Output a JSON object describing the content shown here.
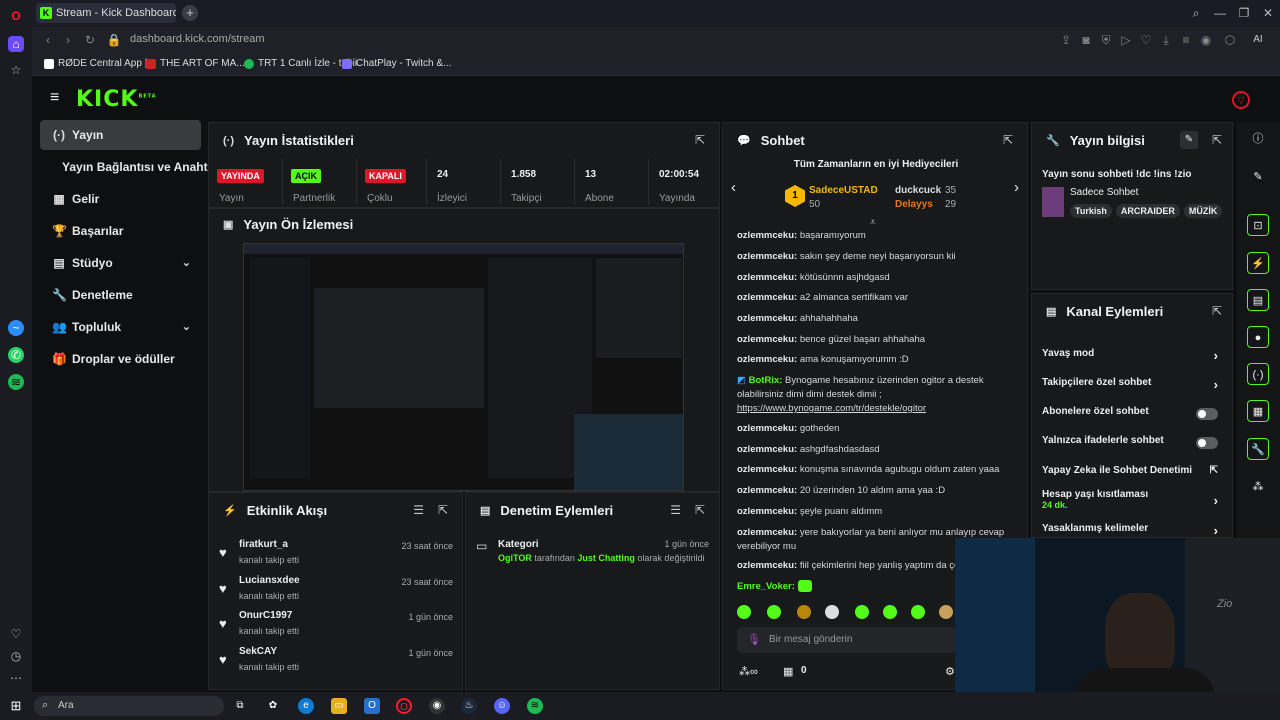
{
  "browser": {
    "tab_title": "Stream - Kick Dashboard",
    "new_tab_symbol": "+",
    "url": "dashboard.kick.com/stream",
    "ai_label": "AI",
    "bookmarks": [
      "RØDE Central App |...",
      "THE ART OF MA...",
      "TRT 1 Canlı İzle - tabii",
      "ChatPlay - Twitch &..."
    ]
  },
  "header": {
    "logo": "KICK",
    "logo_sup": "BETA"
  },
  "nav": {
    "items": [
      {
        "label": "Yayın",
        "icon": "(·)"
      },
      {
        "label": "Yayın Bağlantısı ve Anahtarı",
        "icon": ""
      },
      {
        "label": "Gelir",
        "icon": "▦"
      },
      {
        "label": "Başarılar",
        "icon": "🏆"
      },
      {
        "label": "Stüdyo",
        "icon": "▤"
      },
      {
        "label": "Denetleme",
        "icon": "🔧"
      },
      {
        "label": "Topluluk",
        "icon": "👥"
      },
      {
        "label": "Droplar ve ödüller",
        "icon": "🎁"
      }
    ]
  },
  "stats": {
    "title": "Yayın İstatistikleri",
    "cells": [
      {
        "value": "YAYINDA",
        "label": "Yayın"
      },
      {
        "value": "AÇIK",
        "label": "Partnerlik"
      },
      {
        "value": "KAPALI",
        "label": "Çoklu"
      },
      {
        "value": "24",
        "label": "İzleyici"
      },
      {
        "value": "1.858",
        "label": "Takipçi"
      },
      {
        "value": "13",
        "label": "Abone"
      },
      {
        "value": "02:00:54",
        "label": "Yayında"
      }
    ]
  },
  "preview": {
    "title": "Yayın Ön İzlemesi"
  },
  "activity": {
    "title": "Etkinlik Akışı",
    "items": [
      {
        "name": "firatkurt_a",
        "sub": "kanalı takip etti",
        "time": "23 saat önce"
      },
      {
        "name": "Luciansxdee",
        "sub": "kanalı takip etti",
        "time": "23 saat önce"
      },
      {
        "name": "OnurC1997",
        "sub": "kanalı takip etti",
        "time": "1 gün önce"
      },
      {
        "name": "SekCAY",
        "sub": "kanalı takip etti",
        "time": "1 gün önce"
      }
    ]
  },
  "moderation": {
    "title": "Denetim Eylemleri",
    "item": {
      "title": "Kategori",
      "time": "1 gün önce",
      "user": "OgiTOR",
      "mid": "tarafından",
      "cat": "Just Chatting",
      "tail": "olarak değiştirildi"
    }
  },
  "chat": {
    "title": "Sohbet",
    "gifters_title": "Tüm Zamanların en iyi Hediyecileri",
    "gifters": [
      {
        "rank": "1",
        "name": "SadeceUSTAD",
        "count": "50"
      },
      {
        "name": "duckcuck",
        "count": "35"
      },
      {
        "name": "Delayys",
        "count": "29"
      }
    ],
    "messages": [
      {
        "user": "ozlemmceku:",
        "text": "başaramıyorum"
      },
      {
        "user": "ozlemmceku:",
        "text": "sakın şey deme neyi başarıyorsun kii"
      },
      {
        "user": "ozlemmceku:",
        "text": "kötüsünnn asjhdgasd"
      },
      {
        "user": "ozlemmceku:",
        "text": "a2 almanca sertifikam var"
      },
      {
        "user": "ozlemmceku:",
        "text": "ahhahahhaha"
      },
      {
        "user": "ozlemmceku:",
        "text": "bence güzel başarı ahhahaha"
      },
      {
        "user": "ozlemmceku:",
        "text": "ama konuşamıyorumm :D"
      }
    ],
    "bot": {
      "user": "BotRix:",
      "text": "Bynogame hesabınız üzerinden ogitor a destek olabilirsiniz dimi dimi destek dimii ;",
      "link": "https://www.bynogame.com/tr/destekle/ogitor"
    },
    "messages2": [
      {
        "user": "ozlemmceku:",
        "text": "gotheden"
      },
      {
        "user": "ozlemmceku:",
        "text": "ashgdfashdasdasd"
      },
      {
        "user": "ozlemmceku:",
        "text": "konuşma sınavında agubugu oldum zaten yaaa"
      },
      {
        "user": "ozlemmceku:",
        "text": "20 üzerinden 10 aldım ama yaa :D"
      },
      {
        "user": "ozlemmceku:",
        "text": "şeyle puanı aldımm"
      },
      {
        "user": "ozlemmceku:",
        "text": "yere bakıyorlar ya beni anlıyor mu anlayıp cevap verebiliyor mu"
      },
      {
        "user": "ozlemmceku:",
        "text": "fiil çekimlerini hep yanlış yaptım da çok"
      }
    ],
    "last_user": "Emre_Voker:",
    "input_placeholder": "Bir mesaj gönderin",
    "points": "0"
  },
  "streaminfo": {
    "title": "Yayın bilgisi",
    "stream_title": "Yayın sonu sohbeti !dc !ins !zio",
    "category": "Sadece Sohbet",
    "tags": [
      "Turkish",
      "ARCRAIDER",
      "MÜZİK"
    ]
  },
  "channel_actions": {
    "title": "Kanal Eylemleri",
    "rows": [
      {
        "label": "Yavaş mod",
        "kind": "arrow"
      },
      {
        "label": "Takipçilere özel sohbet",
        "kind": "arrow"
      },
      {
        "label": "Abonelere özel sohbet",
        "kind": "toggle"
      },
      {
        "label": "Yalnızca ifadelerle sohbet",
        "kind": "toggle"
      },
      {
        "label": "Yapay Zeka ile Sohbet Denetimi",
        "kind": "ext"
      },
      {
        "label": "Hesap yaşı kısıtlaması",
        "kind": "arrow",
        "sub": "24 dk."
      },
      {
        "label": "Yasaklanmış kelimeler",
        "kind": "arrow"
      }
    ]
  },
  "taskbar": {
    "search": "Ara"
  },
  "colors": {
    "kick_green": "#53fc18",
    "live_red": "#e0152a",
    "panel": "#18191b"
  }
}
